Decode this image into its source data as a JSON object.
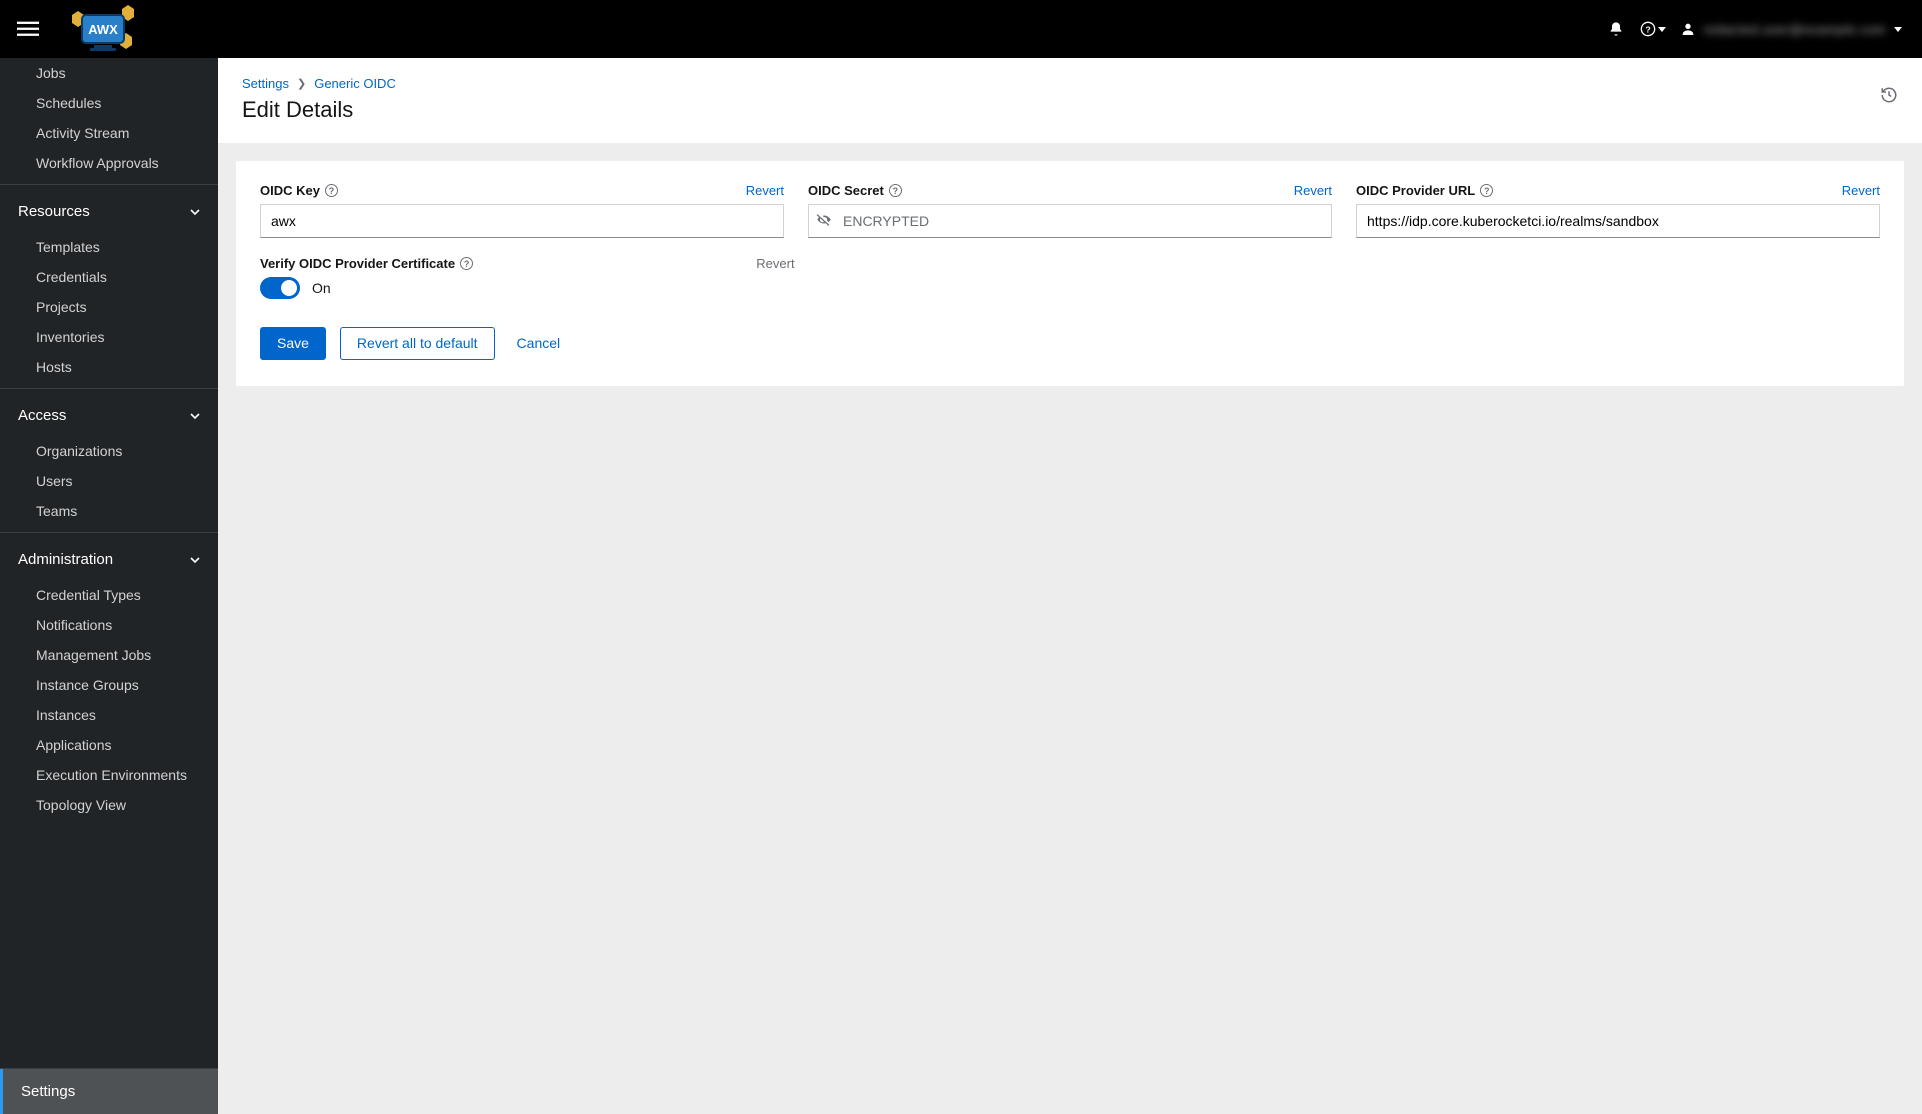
{
  "header": {
    "username": "redacted.user@example.com"
  },
  "sidebar": {
    "views": {
      "items": [
        "Jobs",
        "Schedules",
        "Activity Stream",
        "Workflow Approvals"
      ]
    },
    "resources": {
      "label": "Resources",
      "items": [
        "Templates",
        "Credentials",
        "Projects",
        "Inventories",
        "Hosts"
      ]
    },
    "access": {
      "label": "Access",
      "items": [
        "Organizations",
        "Users",
        "Teams"
      ]
    },
    "administration": {
      "label": "Administration",
      "items": [
        "Credential Types",
        "Notifications",
        "Management Jobs",
        "Instance Groups",
        "Instances",
        "Applications",
        "Execution Environments",
        "Topology View"
      ]
    },
    "settings_label": "Settings"
  },
  "breadcrumb": {
    "root": "Settings",
    "current": "Generic OIDC"
  },
  "page": {
    "title": "Edit Details"
  },
  "form": {
    "oidc_key": {
      "label": "OIDC Key",
      "revert": "Revert",
      "value": "awx"
    },
    "oidc_secret": {
      "label": "OIDC Secret",
      "revert": "Revert",
      "placeholder": "ENCRYPTED",
      "value": ""
    },
    "oidc_provider_url": {
      "label": "OIDC Provider URL",
      "revert": "Revert",
      "value": "https://idp.core.kuberocketci.io/realms/sandbox"
    },
    "verify_cert": {
      "label": "Verify OIDC Provider Certificate",
      "revert": "Revert",
      "state_label": "On",
      "on": true
    }
  },
  "actions": {
    "save": "Save",
    "revert_all": "Revert all to default",
    "cancel": "Cancel"
  }
}
